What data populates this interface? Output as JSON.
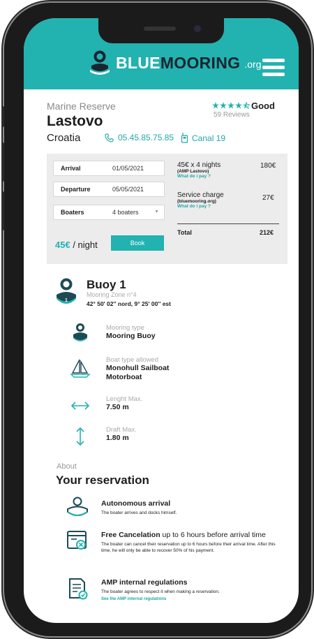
{
  "brand": {
    "name_blue": "BLUE",
    "name_mooring": "MOORING",
    "tld": ".org"
  },
  "colors": {
    "accent": "#22b2b0",
    "header_bg": "#22b2b0",
    "panel_bg": "#ececec",
    "dark": "#1b2530"
  },
  "place": {
    "type": "Marine Reserve",
    "name": "Lastovo",
    "country": "Croatia",
    "phone": "05.45.85.75.85",
    "canal": "Canal 19",
    "rating_stars": 4.5,
    "rating_word": "Good",
    "reviews": "59 Reviews"
  },
  "booking": {
    "arrival_label": "Arrival",
    "arrival_value": "01/05/2021",
    "departure_label": "Departure",
    "departure_value": "05/05/2021",
    "boaters_label": "Boaters",
    "boaters_value": "4 boaters",
    "price_value": "45€",
    "price_unit": "/ night",
    "book_label": "Book",
    "nights_line": "45€ x 4 nights",
    "nights_sub": "(AMP Lastovo)",
    "nights_link": "What do i pay ?",
    "nights_amount": "180€",
    "service_line": "Service charge",
    "service_sub": "(bluemooring.org)",
    "service_link": "What do i pay ?",
    "service_amount": "27€",
    "total_label": "Total",
    "total_amount": "212€"
  },
  "buoy": {
    "number": "1",
    "title": "Buoy 1",
    "zone": "Mooring Zone n°4",
    "coords": "42° 50' 02'' nord, 9° 25' 00'' est"
  },
  "specs": {
    "mooring_type_label": "Mooring type",
    "mooring_type_value": "Mooring Buoy",
    "boat_type_label": "Boat type allowed",
    "boat_type_value_1": "Monohull Sailboat",
    "boat_type_value_2": "Motorboat",
    "length_label": "Lenght Max.",
    "length_value": "7.50 m",
    "draft_label": "Draft Max.",
    "draft_value": "1.80 m"
  },
  "about": {
    "label": "About",
    "title": "Your reservation",
    "f1_title": "Autonomous arrival",
    "f1_desc": "The boater arrives and docks himself.",
    "f2_title_bold": "Free Cancelation",
    "f2_title_rest": " up to 6 hours before arrival time",
    "f2_desc": "The boater can cancel their reservation up to 6 hours before their arrival time. After this time, he will only be able to recover 50% of his payment.",
    "f3_title": "AMP internal regulations",
    "f3_desc": "The boater agrees to respect it when making a reservation.",
    "f3_link": "See the AMP internal regulations"
  }
}
